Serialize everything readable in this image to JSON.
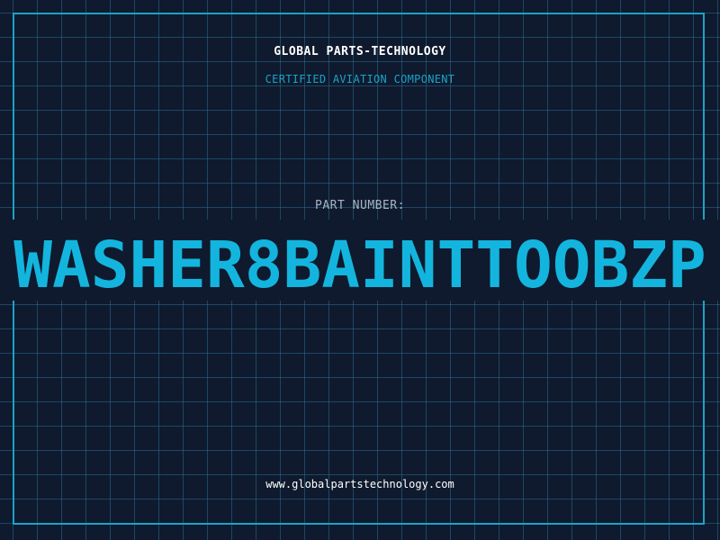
{
  "header": {
    "company": "GLOBAL PARTS-TECHNOLOGY",
    "tagline": "CERTIFIED AVIATION COMPONENT"
  },
  "part": {
    "label": "PART NUMBER:",
    "number": "WASHER8BAINTTOOBZP"
  },
  "footer": {
    "website": "www.globalpartstechnology.com"
  },
  "colors": {
    "background": "#0f1a2e",
    "accent": "#1aa3c7",
    "part_number": "#13b5de",
    "label": "#a8b4c4",
    "text": "#ffffff"
  }
}
